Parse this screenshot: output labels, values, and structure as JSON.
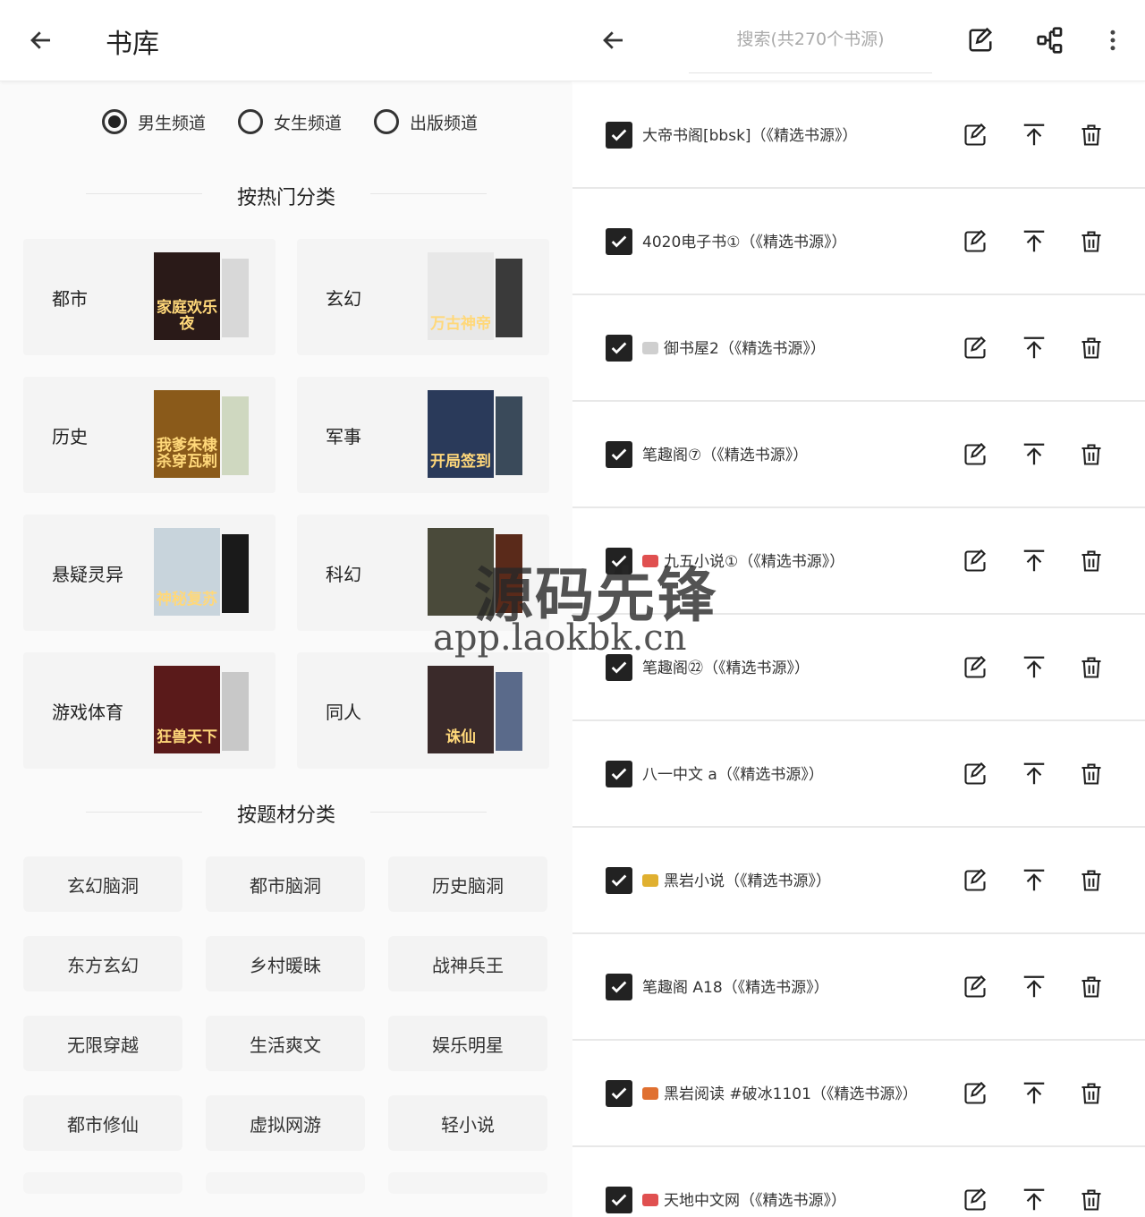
{
  "left": {
    "title": "书库",
    "channels": [
      {
        "label": "男生频道",
        "selected": true
      },
      {
        "label": "女生频道",
        "selected": false
      },
      {
        "label": "出版频道",
        "selected": false
      }
    ],
    "hot_title": "按热门分类",
    "hot_categories": [
      {
        "label": "都市",
        "cover_text": "家庭欢乐夜",
        "cover_color": "#2a1a18",
        "back_color": "#d8d8d8"
      },
      {
        "label": "玄幻",
        "cover_text": "万古神帝",
        "cover_color": "#e8e8e8",
        "back_color": "#3a3a3a"
      },
      {
        "label": "历史",
        "cover_text": "我爹朱棣杀穿瓦剌",
        "cover_color": "#8a5a1a",
        "back_color": "#cfd8c0"
      },
      {
        "label": "军事",
        "cover_text": "开局签到",
        "cover_color": "#2a3a5a",
        "back_color": "#3a4a5a"
      },
      {
        "label": "悬疑灵异",
        "cover_text": "神秘复苏",
        "cover_color": "#c8d4dc",
        "back_color": "#1a1a1a"
      },
      {
        "label": "科幻",
        "cover_text": "",
        "cover_color": "#4a4a3a",
        "back_color": "#5a2a1a"
      },
      {
        "label": "游戏体育",
        "cover_text": "狂兽天下",
        "cover_color": "#5a1a1a",
        "back_color": "#c8c8c8"
      },
      {
        "label": "同人",
        "cover_text": "诛仙",
        "cover_color": "#3a2a2a",
        "back_color": "#5a6a8a"
      }
    ],
    "theme_title": "按题材分类",
    "theme_tags": [
      "玄幻脑洞",
      "都市脑洞",
      "历史脑洞",
      "东方玄幻",
      "乡村暖昧",
      "战神兵王",
      "无限穿越",
      "生活爽文",
      "娱乐明星",
      "都市修仙",
      "虚拟网游",
      "轻小说"
    ]
  },
  "right": {
    "search_placeholder": "搜索(共270个书源)",
    "sources": [
      {
        "name": "大帝书阁[bbsk]（《精选书源》）",
        "emoji_color": ""
      },
      {
        "name": "4020电子书①（《精选书源》）",
        "emoji_color": ""
      },
      {
        "name": "御书屋2（《精选书源》）",
        "emoji_color": "#cfcfcf"
      },
      {
        "name": "笔趣阁⑦（《精选书源》）",
        "emoji_color": ""
      },
      {
        "name": "九五小说①（《精选书源》）",
        "emoji_color": "#e05050"
      },
      {
        "name": "笔趣阁㉒（《精选书源》）",
        "emoji_color": ""
      },
      {
        "name": "八一中文 a（《精选书源》）",
        "emoji_color": ""
      },
      {
        "name": "黑岩小说（《精选书源》）",
        "emoji_color": "#e0b030"
      },
      {
        "name": "笔趣阁 A18（《精选书源》）",
        "emoji_color": ""
      },
      {
        "name": "黑岩阅读 #破冰1101（《精选书源》）",
        "emoji_color": "#e07030"
      },
      {
        "name": "天地中文网（《精选书源》）",
        "emoji_color": "#e05050"
      }
    ]
  },
  "watermark": {
    "line1": "源码先锋",
    "line2": "app.laokbk.cn"
  }
}
